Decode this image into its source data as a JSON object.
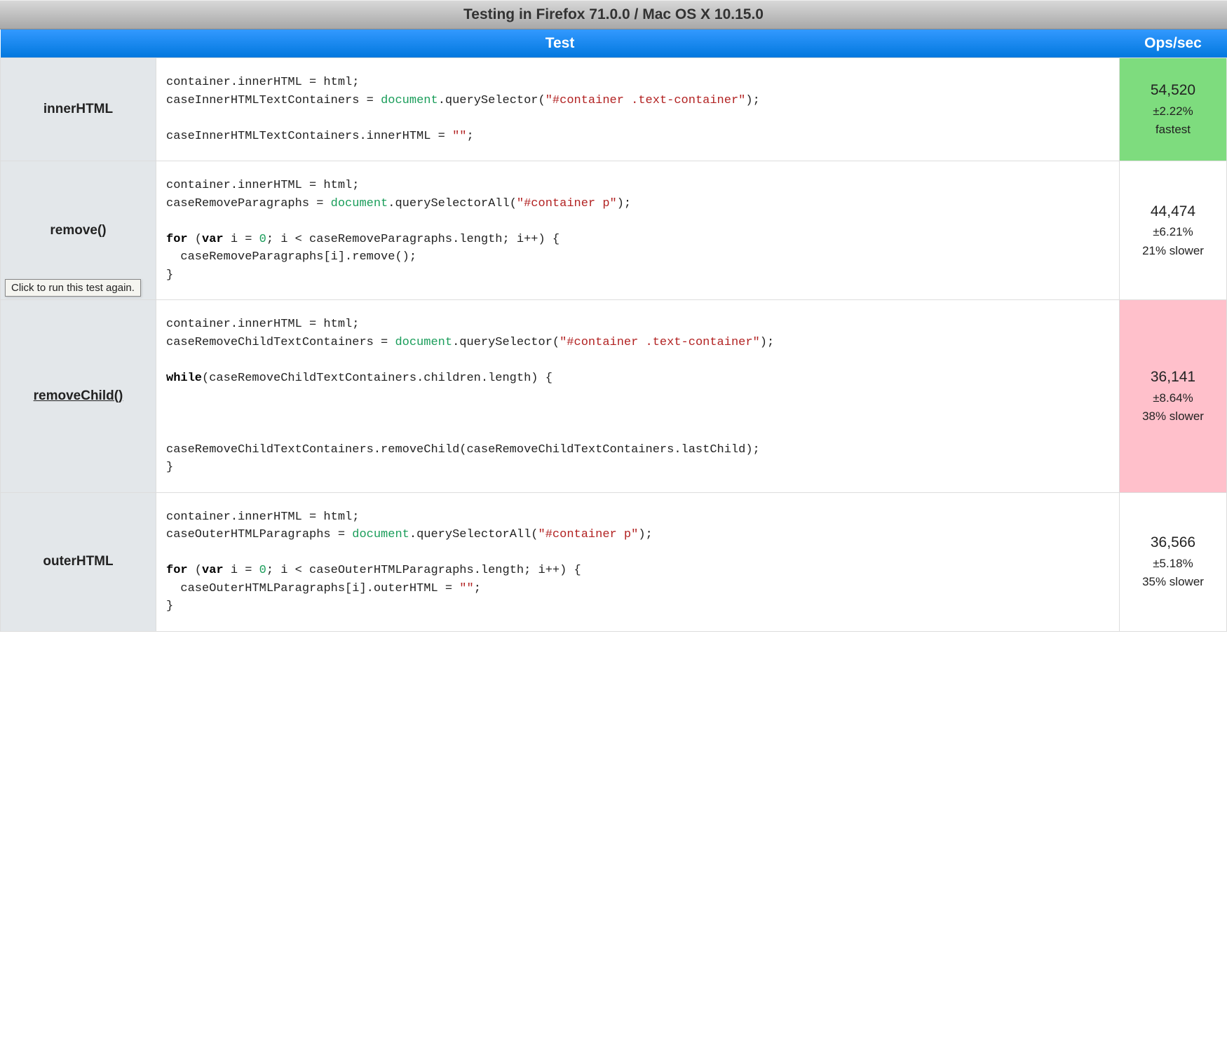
{
  "header": {
    "title": "Testing in Firefox 71.0.0 / Mac OS X 10.15.0"
  },
  "columns": {
    "test": "Test",
    "ops": "Ops/sec"
  },
  "tooltip": "Click to run this test again.",
  "tests": [
    {
      "name": "innerHTML",
      "code_html": "container.innerHTML = html;\ncaseInnerHTMLTextContainers = <span class=\"tok-global\">document</span>.querySelector(<span class=\"tok-str\">\"#container .text-container\"</span>);\n\ncaseInnerHTMLTextContainers.innerHTML = <span class=\"tok-str\">\"\"</span>;",
      "ops": "54,520",
      "variance": "±2.22%",
      "note": "fastest",
      "status": "fastest"
    },
    {
      "name": "remove()",
      "code_html": "container.innerHTML = html;\ncaseRemoveParagraphs = <span class=\"tok-global\">document</span>.querySelectorAll(<span class=\"tok-str\">\"#container p\"</span>);\n\n<span class=\"tok-kw\">for</span> (<span class=\"tok-kw\">var</span> i = <span class=\"tok-num\">0</span>; i &lt; caseRemoveParagraphs.length; i++) {\n  caseRemoveParagraphs[i].remove();\n}",
      "ops": "44,474",
      "variance": "±6.21%",
      "note": "21% slower",
      "status": "normal"
    },
    {
      "name": "removeChild()",
      "code_html": "container.innerHTML = html;\ncaseRemoveChildTextContainers = <span class=\"tok-global\">document</span>.querySelector(<span class=\"tok-str\">\"#container .text-container\"</span>);\n\n<span class=\"tok-kw\">while</span>(caseRemoveChildTextContainers.children.length) {\n\n\n\ncaseRemoveChildTextContainers.removeChild(caseRemoveChildTextContainers.lastChild);\n}",
      "ops": "36,141",
      "variance": "±8.64%",
      "note": "38% slower",
      "status": "slowest",
      "hovered": true
    },
    {
      "name": "outerHTML",
      "code_html": "container.innerHTML = html;\ncaseOuterHTMLParagraphs = <span class=\"tok-global\">document</span>.querySelectorAll(<span class=\"tok-str\">\"#container p\"</span>);\n\n<span class=\"tok-kw\">for</span> (<span class=\"tok-kw\">var</span> i = <span class=\"tok-num\">0</span>; i &lt; caseOuterHTMLParagraphs.length; i++) {\n  caseOuterHTMLParagraphs[i].outerHTML = <span class=\"tok-str\">\"\"</span>;\n}",
      "ops": "36,566",
      "variance": "±5.18%",
      "note": "35% slower",
      "status": "normal"
    }
  ]
}
